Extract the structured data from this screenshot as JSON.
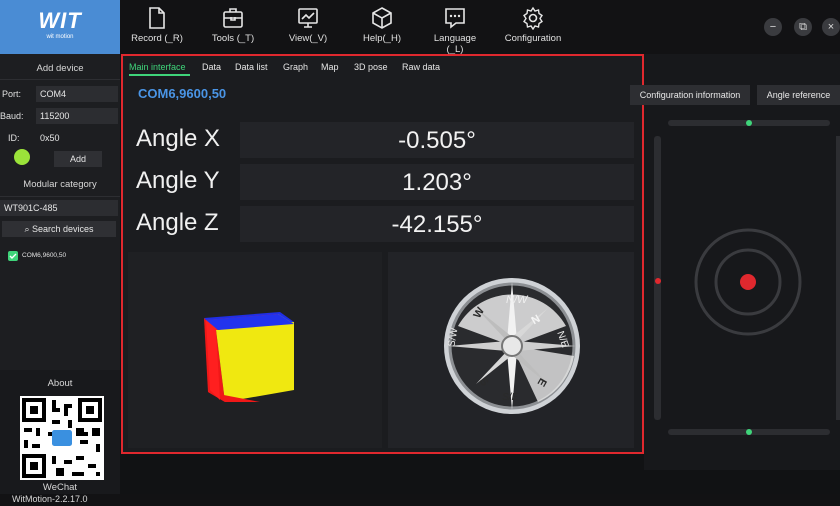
{
  "logo": {
    "brand": "WIT",
    "tagline": "wit motion"
  },
  "toolbar": {
    "items": [
      {
        "label": "Record (_R)",
        "icon": "file-icon"
      },
      {
        "label": "Tools (_T)",
        "icon": "toolbox-icon"
      },
      {
        "label": "View(_V)",
        "icon": "monitor-chart-icon"
      },
      {
        "label": "Help(_H)",
        "icon": "cube-icon"
      },
      {
        "label": "Language (_L)",
        "icon": "chat-bubble-icon"
      },
      {
        "label": "Configuration",
        "icon": "gear-icon"
      }
    ],
    "window": {
      "minimize": "−",
      "restore": "⧉",
      "close": "×"
    }
  },
  "sidebar": {
    "add_device": "Add device",
    "port_label": "Port:",
    "port_value": "COM4",
    "baud_label": "Baud:",
    "baud_value": "115200",
    "id_label": "ID:",
    "id_value": "0x50",
    "add_button": "Add",
    "modular_category": "Modular category",
    "model_value": "WT901C-485",
    "search_button": "Search devices",
    "device_item": "COM6,9600,50",
    "about": "About",
    "wechat": "WeChat",
    "status_led_color": "#9be33a"
  },
  "main": {
    "tabs": [
      "Main interface",
      "Data",
      "Data list",
      "Graph",
      "Map",
      "3D pose",
      "Raw data"
    ],
    "active_tab": 0,
    "device_title": "COM6,9600,50",
    "accent": "#3fd47a",
    "angles": [
      {
        "label": "Angle X",
        "value": "-0.505°"
      },
      {
        "label": "Angle Y",
        "value": "1.203°"
      },
      {
        "label": "Angle Z",
        "value": "-42.155°"
      }
    ],
    "compass": {
      "n": "N",
      "s": "S",
      "e": "E",
      "w": "W",
      "ne": "N/E",
      "nw": "N/W",
      "se": "S/E",
      "sw": "S/W"
    }
  },
  "right": {
    "config_info_button": "Configuration information",
    "angle_reference_button": "Angle reference"
  },
  "status": {
    "version": "WitMotion-2.2.17.0"
  }
}
